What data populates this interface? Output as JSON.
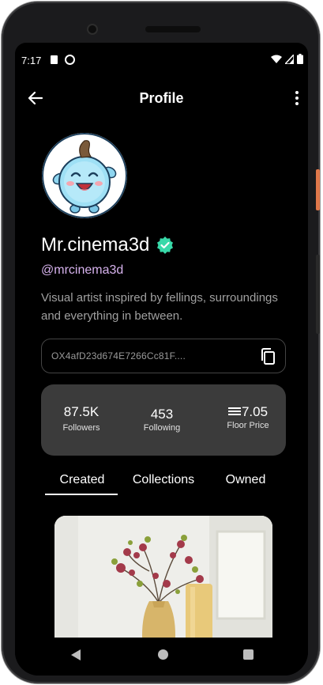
{
  "status_bar": {
    "time": "7:17"
  },
  "header": {
    "title": "Profile"
  },
  "profile": {
    "name": "Mr.cinema3d",
    "handle": "@mrcinema3d",
    "bio": "Visual artist inspired by fellings, surroundings and everything in between.",
    "wallet_address": "OX4afD23d674E7266Cc81F...."
  },
  "stats": {
    "followers_value": "87.5K",
    "followers_label": "Followers",
    "following_value": "453",
    "following_label": "Following",
    "floor_value": "7.05",
    "floor_label": "Floor Price"
  },
  "tabs": [
    {
      "label": "Created",
      "active": true
    },
    {
      "label": "Collections",
      "active": false
    },
    {
      "label": "Owned",
      "active": false
    }
  ],
  "colors": {
    "verified": "#38d9a9",
    "handle": "#d7b3ee",
    "stats_bg": "#3b3b3b"
  },
  "icons": [
    "arrow-left-icon",
    "more-vertical-icon",
    "verified-badge-icon",
    "copy-icon",
    "ethereum-icon"
  ]
}
